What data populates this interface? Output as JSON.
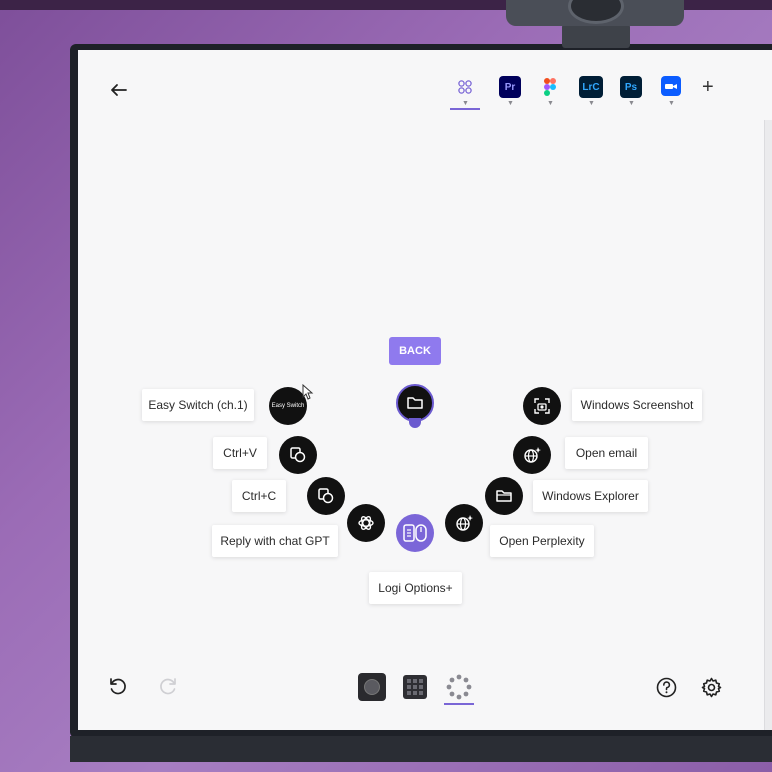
{
  "toolbar": {
    "apps": [
      {
        "name": "all-apps",
        "label": ""
      },
      {
        "name": "premiere-pro",
        "label": "Pr",
        "color": "#00005b",
        "text_color": "#9999ff"
      },
      {
        "name": "figma",
        "label": ""
      },
      {
        "name": "lightroom-classic",
        "label": "LrC",
        "color": "#001e36",
        "text_color": "#31a8ff"
      },
      {
        "name": "photoshop",
        "label": "Ps",
        "color": "#001e36",
        "text_color": "#31a8ff"
      },
      {
        "name": "zoom",
        "label": ""
      }
    ],
    "active_tab_color": "#7a66d6"
  },
  "radial_menu": {
    "back_label": "BACK",
    "center_label": "Logi Options+",
    "left_actions": [
      {
        "label": "Easy Switch (ch.1)",
        "icon": "easy-switch-icon",
        "icon_text": "Easy Switch"
      },
      {
        "label": "Ctrl+V",
        "icon": "copy-paste-icon"
      },
      {
        "label": "Ctrl+C",
        "icon": "copy-paste-icon"
      },
      {
        "label": "Reply with chat GPT",
        "icon": "openai-icon"
      }
    ],
    "right_actions": [
      {
        "label": "Windows Screenshot",
        "icon": "screenshot-icon"
      },
      {
        "label": "Open email",
        "icon": "web-sparkle-icon"
      },
      {
        "label": "Windows Explorer",
        "icon": "folder-icon"
      },
      {
        "label": "Open Perplexity",
        "icon": "web-sparkle-icon"
      }
    ],
    "top_action_icon": "folder-icon",
    "accent_color": "#8f7aee"
  },
  "bottom_bar": {
    "left": [
      "undo-icon",
      "redo-icon"
    ],
    "views": [
      "mouse-view-icon",
      "keypad-view-icon",
      "radial-view-icon"
    ],
    "active_view": "radial-view-icon",
    "right": [
      "help-icon",
      "settings-icon"
    ]
  }
}
